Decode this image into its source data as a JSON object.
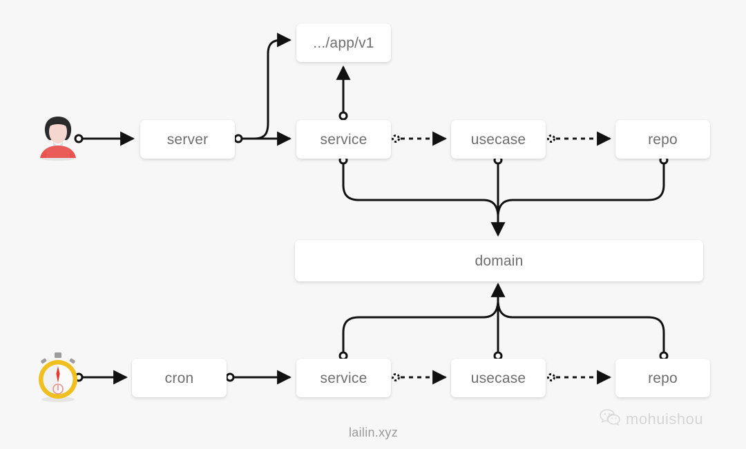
{
  "diagram": {
    "background_color": "#f7f7f7",
    "node_fill": "#ffffff",
    "node_text_color": "#6e6e6e",
    "edge_color": "#111111",
    "title_footer": "lailin.xyz",
    "watermark_label": "mohuishou",
    "watermark_icon": "wechat-icon"
  },
  "actors": [
    {
      "id": "user",
      "icon": "user-avatar-icon",
      "description": "person with dark hair and red shirt",
      "colors": {
        "hair": "#2b2b2b",
        "face": "#f6d7d0",
        "shirt": "#e8534f",
        "collar": "#cfe0e4"
      }
    },
    {
      "id": "timer",
      "icon": "stopwatch-icon",
      "description": "stopwatch with gold ring and red needle",
      "colors": {
        "ring": "#f0c020",
        "face": "#fbfbfb",
        "needle": "#e23b2e",
        "crown": "#9c9c9c"
      }
    }
  ],
  "nodes": [
    {
      "id": "app_v1",
      "label": ".../app/v1",
      "row": "top"
    },
    {
      "id": "server",
      "label": "server",
      "row": "top"
    },
    {
      "id": "service_top",
      "label": "service",
      "row": "top"
    },
    {
      "id": "usecase_top",
      "label": "usecase",
      "row": "top"
    },
    {
      "id": "repo_top",
      "label": "repo",
      "row": "top"
    },
    {
      "id": "domain",
      "label": "domain",
      "row": "middle"
    },
    {
      "id": "cron",
      "label": "cron",
      "row": "bottom"
    },
    {
      "id": "service_bottom",
      "label": "service",
      "row": "bottom"
    },
    {
      "id": "usecase_bottom",
      "label": "usecase",
      "row": "bottom"
    },
    {
      "id": "repo_bottom",
      "label": "repo",
      "row": "bottom"
    }
  ],
  "edges": [
    {
      "from": "user",
      "to": "server",
      "style": "solid"
    },
    {
      "from": "server",
      "to": "app_v1",
      "style": "solid"
    },
    {
      "from": "server",
      "to": "service_top",
      "style": "solid"
    },
    {
      "from": "service_top",
      "to": "app_v1",
      "style": "solid"
    },
    {
      "from": "service_top",
      "to": "usecase_top",
      "style": "dotted"
    },
    {
      "from": "usecase_top",
      "to": "repo_top",
      "style": "dotted"
    },
    {
      "from": "service_top",
      "to": "domain",
      "style": "solid"
    },
    {
      "from": "usecase_top",
      "to": "domain",
      "style": "solid"
    },
    {
      "from": "repo_top",
      "to": "domain",
      "style": "solid"
    },
    {
      "from": "timer",
      "to": "cron",
      "style": "solid"
    },
    {
      "from": "cron",
      "to": "service_bottom",
      "style": "solid"
    },
    {
      "from": "service_bottom",
      "to": "usecase_bottom",
      "style": "dotted"
    },
    {
      "from": "usecase_bottom",
      "to": "repo_bottom",
      "style": "dotted"
    },
    {
      "from": "service_bottom",
      "to": "domain",
      "style": "solid"
    },
    {
      "from": "usecase_bottom",
      "to": "domain",
      "style": "solid"
    },
    {
      "from": "repo_bottom",
      "to": "domain",
      "style": "solid"
    }
  ]
}
